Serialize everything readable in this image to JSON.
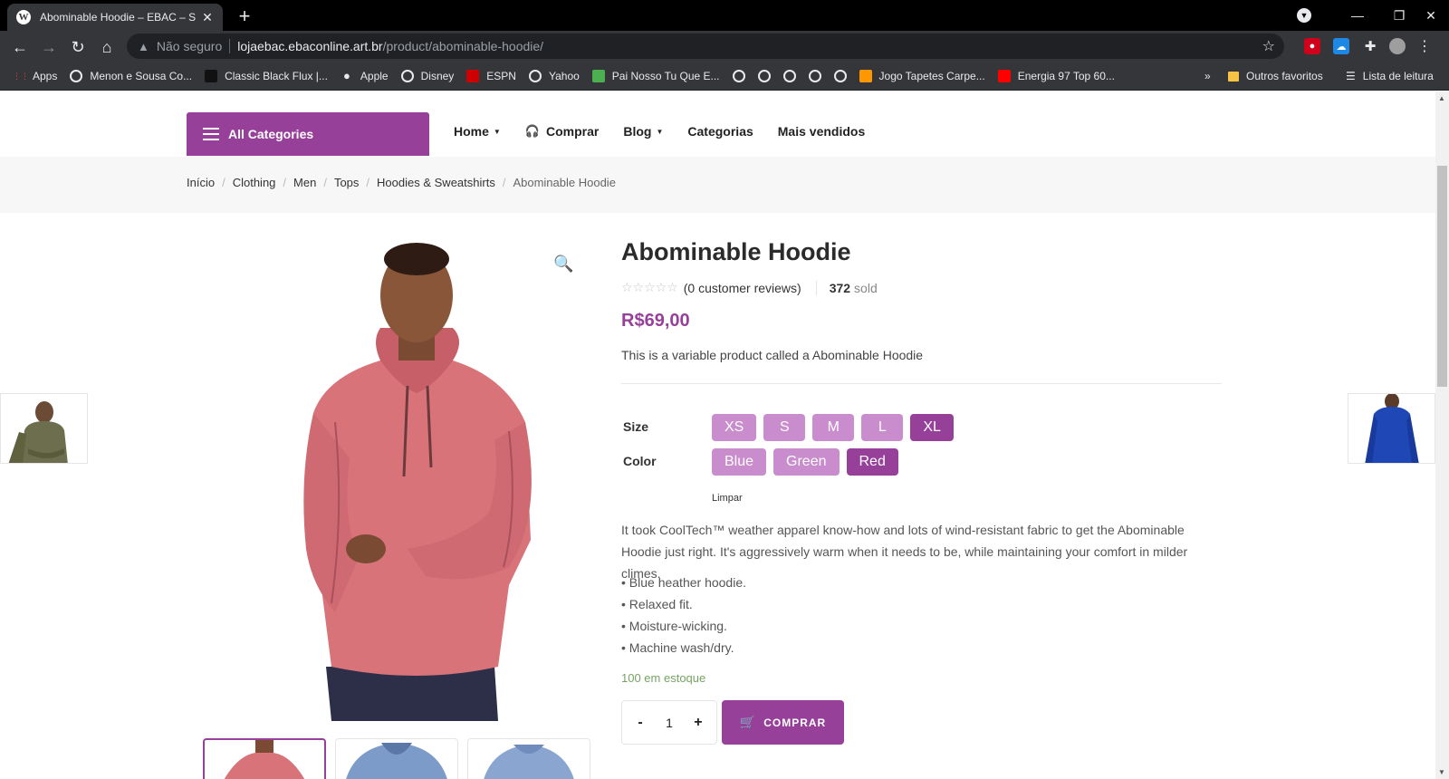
{
  "browser": {
    "tab_title": "Abominable Hoodie – EBAC – Sh",
    "tab_icon": "W",
    "new_tab": "+",
    "win_minimize": "—",
    "win_restore": "❐",
    "win_close": "✕",
    "back": "←",
    "forward": "→",
    "reload": "↻",
    "home": "⌂",
    "security_label": "Não seguro",
    "url_host": "lojaebac.ebaconline.art.br",
    "url_path": "/product/abominable-hoodie/",
    "star": "☆",
    "menu_dots": "⋮",
    "bookmarks": [
      {
        "label": "Apps",
        "icon": "apps-grid-icon",
        "color": "#ea4335"
      },
      {
        "label": "Menon e Sousa Co...",
        "icon": "globe-icon",
        "color": "#e8eaed"
      },
      {
        "label": "Classic Black Flux |...",
        "icon": "site-icon",
        "color": "#111111"
      },
      {
        "label": "Apple",
        "icon": "apple-icon",
        "color": "#e8eaed"
      },
      {
        "label": "Disney",
        "icon": "globe-icon",
        "color": "#e8eaed"
      },
      {
        "label": "ESPN",
        "icon": "espn-icon",
        "color": "#d00000"
      },
      {
        "label": "Yahoo",
        "icon": "globe-icon",
        "color": "#e8eaed"
      },
      {
        "label": "Pai Nosso Tu Que E...",
        "icon": "site-icon",
        "color": "#4caf50"
      },
      {
        "label": "",
        "icon": "globe-icon",
        "color": "#e8eaed"
      },
      {
        "label": "",
        "icon": "globe-icon",
        "color": "#e8eaed"
      },
      {
        "label": "",
        "icon": "globe-icon",
        "color": "#e8eaed"
      },
      {
        "label": "",
        "icon": "globe-icon",
        "color": "#e8eaed"
      },
      {
        "label": "",
        "icon": "globe-icon",
        "color": "#e8eaed"
      },
      {
        "label": "Jogo Tapetes Carpe...",
        "icon": "site-icon",
        "color": "#ff9800"
      },
      {
        "label": "Energia 97 Top 60...",
        "icon": "youtube-icon",
        "color": "#ff0000"
      }
    ],
    "bookmarks_more": "»",
    "other_bookmarks": "Outros favoritos",
    "reading_list": "Lista de leitura"
  },
  "site": {
    "all_categories": "All Categories",
    "menu": [
      {
        "label": "Home",
        "has_caret": true
      },
      {
        "label": "Comprar",
        "has_icon": true
      },
      {
        "label": "Blog",
        "has_caret": true
      },
      {
        "label": "Categorias"
      },
      {
        "label": "Mais vendidos"
      }
    ],
    "caret": "▼",
    "headset": "🎧",
    "breadcrumbs": [
      "Início",
      "Clothing",
      "Men",
      "Tops",
      "Hoodies & Sweatshirts",
      "Abominable Hoodie"
    ],
    "crumb_sep": "/"
  },
  "product": {
    "title": "Abominable Hoodie",
    "stars": "☆☆☆☆☆",
    "reviews": "(0 customer reviews)",
    "sold_count": "372",
    "sold_label": "sold",
    "price": "R$69,00",
    "short_description": "This is a variable product called a Abominable Hoodie",
    "size_label": "Size",
    "sizes": [
      "XS",
      "S",
      "M",
      "L",
      "XL"
    ],
    "selected_size": "XL",
    "color_label": "Color",
    "colors": [
      "Blue",
      "Green",
      "Red"
    ],
    "selected_color": "Red",
    "clear_label": "Limpar",
    "description": "It took CoolTech™ weather apparel know-how and lots of wind-resistant fabric to get the Abominable Hoodie just right. It's aggressively warm when it needs to be, while maintaining your comfort in milder climes.",
    "features": [
      "• Blue heather hoodie.",
      "• Relaxed fit.",
      "• Moisture-wicking.",
      "• Machine wash/dry."
    ],
    "stock": "100 em estoque",
    "qty_minus": "-",
    "quantity": "1",
    "qty_plus": "+",
    "buy_label": "COMPRAR",
    "zoom_icon": "🔍",
    "colors_hex": {
      "accent": "#96409a",
      "accent_light": "#c98ccd",
      "stock": "#77a464"
    }
  }
}
